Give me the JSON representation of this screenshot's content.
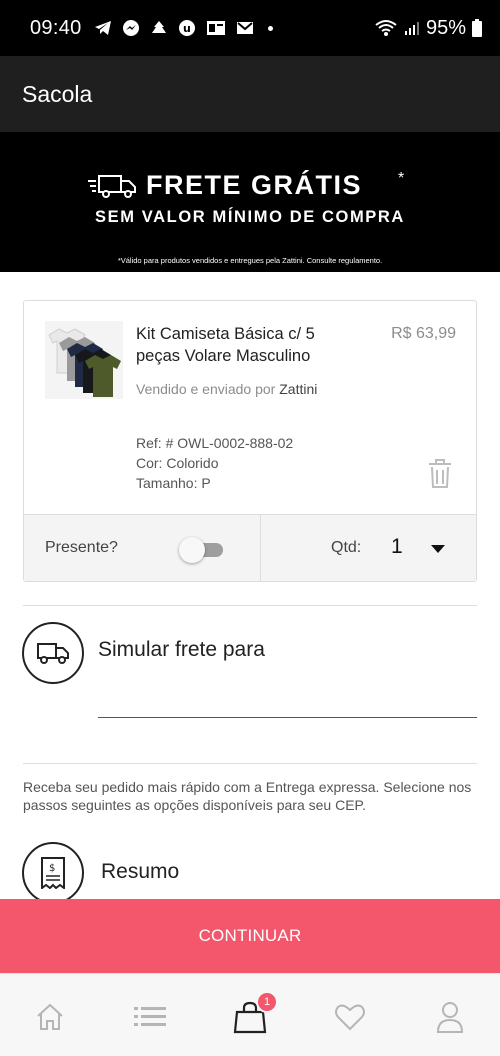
{
  "status_bar": {
    "time": "09:40",
    "battery": "95%",
    "icons": [
      "telegram-icon",
      "messenger-icon",
      "notification-icon",
      "app-icon",
      "outlook-icon",
      "gmail-icon",
      "wifi-icon",
      "signal-icon",
      "battery-icon"
    ]
  },
  "app_bar": {
    "title": "Sacola"
  },
  "banner": {
    "headline": "FRETE GRÁTIS",
    "asterisk": "*",
    "subline": "SEM VALOR MÍNIMO DE COMPRA",
    "note": "*Válido para produtos vendidos e entregues pela Zattini. Consulte regulamento."
  },
  "cart_item": {
    "name": "Kit Camiseta Básica c/ 5 peças Volare Masculino",
    "price": "R$ 63,99",
    "seller_prefix": "Vendido e enviado por",
    "seller": "Zattini",
    "ref": "Ref: # OWL-0002-888-02",
    "color": "Cor: Colorido",
    "size": "Tamanho: P",
    "gift_label": "Presente?",
    "gift_enabled": false,
    "qty_label": "Qtd:",
    "qty_value": "1"
  },
  "shipping": {
    "title": "Simular frete para",
    "input_value": "",
    "express_text": "Receba seu pedido mais rápido com a Entrega expressa. Selecione nos passos seguintes as opções disponíveis para seu CEP."
  },
  "summary": {
    "title": "Resumo"
  },
  "continue_label": "CONTINUAR",
  "bottom_nav": {
    "items": [
      "home-icon",
      "list-icon",
      "bag-icon",
      "heart-icon",
      "profile-icon"
    ],
    "bag_badge": "1",
    "active_color": "#222222",
    "inactive_color": "#b5b5b5"
  },
  "colors": {
    "accent": "#f4566b",
    "banner_bg": "#000000",
    "app_bar_bg": "#1f1f1f"
  }
}
